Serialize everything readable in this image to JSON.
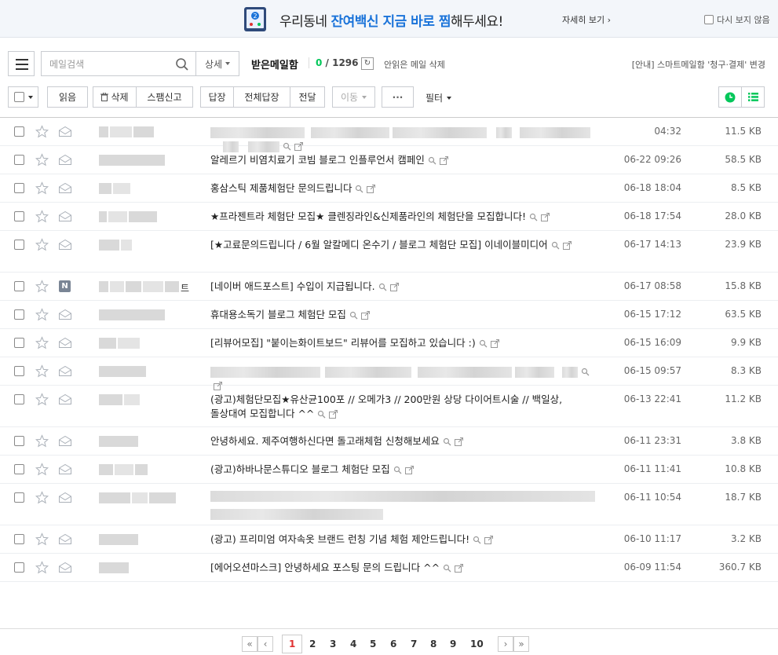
{
  "banner": {
    "text_pre": "우리동네 ",
    "text_highlight": "잔여백신 지금 바로 찜",
    "text_post": "해두세요!",
    "more_label": "자세히 보기",
    "close_label": "다시 보지 않음"
  },
  "toolbar": {
    "search_placeholder": "메일검색",
    "detail_label": "상세",
    "box_title": "받은메일함",
    "unread_count": "0",
    "total_count": "1296",
    "delete_read_label": "안읽은 메일 삭제",
    "notice": "[안내] 스마트메일함 '청구·결제' 변경",
    "read_label": "읽음",
    "delete_label": "삭제",
    "spam_label": "스팸신고",
    "reply_label": "답장",
    "reply_all_label": "전체답장",
    "forward_label": "전달",
    "move_label": "이동",
    "more_label": "···",
    "filter_label": "필터"
  },
  "mails": [
    {
      "subject": "",
      "date": "04:32",
      "size": "11.5 KB"
    },
    {
      "subject": "알레르기 비염치료기 코빔 블로그 인플루언서 캠페인",
      "date": "06-22 09:26",
      "size": "58.5 KB"
    },
    {
      "subject": "홍삼스틱 제품체험단 문의드립니다",
      "date": "06-18 18:04",
      "size": "8.5 KB"
    },
    {
      "subject": "★프라젠트라 체험단 모집★ 클렌징라인&신제품라인의 체험단을 모집합니다!",
      "date": "06-18 17:54",
      "size": "28.0 KB"
    },
    {
      "subject": "[★고료문의드립니다 / 6월 알칼메디 온수기 / 블로그 체험단 모집] 이네이블미디어",
      "date": "06-17 14:13",
      "size": "23.9 KB"
    },
    {
      "sender_tail": "트",
      "subject": "[네이버 애드포스트] 수입이 지급됩니다.",
      "date": "06-17 08:58",
      "size": "15.8 KB"
    },
    {
      "subject": "휴대용소독기 블로그 체험단 모집",
      "date": "06-15 17:12",
      "size": "63.5 KB"
    },
    {
      "subject": "[리뷰어모집] \"붙이는화이트보드\" 리뷰어를 모집하고 있습니다 :)",
      "date": "06-15 16:09",
      "size": "9.9 KB"
    },
    {
      "subject": "",
      "date": "06-15 09:57",
      "size": "8.3 KB"
    },
    {
      "subject": "(광고)체험단모집★유산균100포 // 오메가3 // 200만원 상당 다이어트시술 // 백일상, 돌상대여 모집합니다 ^^",
      "date": "06-13 22:41",
      "size": "11.2 KB"
    },
    {
      "subject": "안녕하세요. 제주여행하신다면 돌고래체험 신청해보세요",
      "date": "06-11 23:31",
      "size": "3.8 KB"
    },
    {
      "subject": "(광고)하바나문스튜디오 블로그 체험단 모집",
      "date": "06-11 11:41",
      "size": "10.8 KB"
    },
    {
      "subject": "",
      "date": "06-11 10:54",
      "size": "18.7 KB"
    },
    {
      "subject": "(광고) 프리미엄 여자속옷 브랜드 런칭 기념 체험 제안드립니다!",
      "date": "06-10 11:17",
      "size": "3.2 KB"
    },
    {
      "subject": "[에어오션마스크] 안녕하세요 포스팅 문의 드립니다 ^^",
      "date": "06-09 11:54",
      "size": "360.7 KB"
    }
  ],
  "pagination": {
    "current": "1",
    "pages": [
      "1",
      "2",
      "3",
      "4",
      "5",
      "6",
      "7",
      "8",
      "9",
      "10"
    ]
  },
  "colors": {
    "accent_blue": "#1a73d9",
    "unread_green": "#03c75a",
    "current_page_red": "#e03131"
  }
}
